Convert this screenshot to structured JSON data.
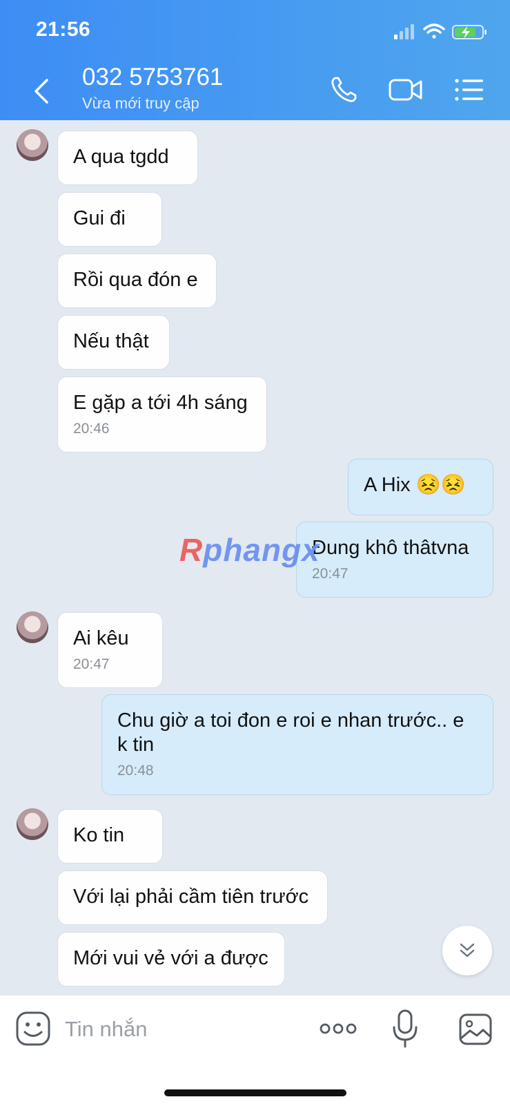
{
  "status_bar": {
    "time": "21:56"
  },
  "header": {
    "title": "032 5753761",
    "subtitle": "Vừa mới truy cập"
  },
  "messages": [
    {
      "text": "A qua tgdd"
    },
    {
      "text": "Gui đi"
    },
    {
      "text": "Rồi qua đón e"
    },
    {
      "text": "Nếu thật"
    },
    {
      "text": "E gặp a tới 4h sáng",
      "time": "20:46"
    },
    {
      "text": "A Hix 😣😣"
    },
    {
      "text": "Đung khô thâtvna",
      "time": "20:47"
    },
    {
      "text": "Ai kêu",
      "time": "20:47"
    },
    {
      "text": "Chu giờ a toi đon e roi e nhan trước.. e k tin",
      "time": "20:48"
    },
    {
      "text": "Ko tin"
    },
    {
      "text": "Với lại phải cầm tiên trước"
    },
    {
      "text": "Mới vui vẻ với a được"
    }
  ],
  "watermark": {
    "first": "R",
    "rest": "phangx"
  },
  "input": {
    "placeholder": "Tin nhắn"
  },
  "colors": {
    "header_start": "#3d8df5",
    "header_end": "#4fa6ee",
    "chat_bg": "#e2e9f1",
    "outgoing_bubble": "#d6ecfb",
    "incoming_bubble": "#fefefe"
  }
}
